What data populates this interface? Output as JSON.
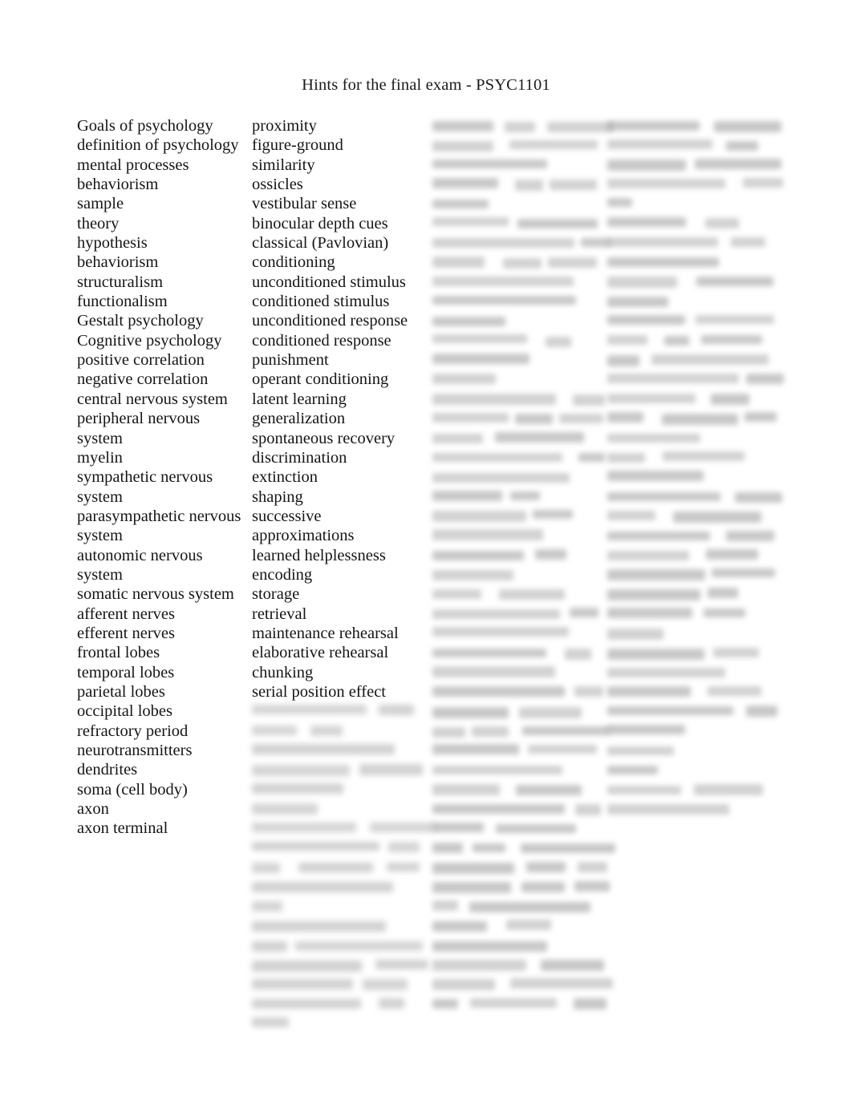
{
  "document": {
    "title": "Hints for the final exam - PSYC1101",
    "page_background": "#ffffff",
    "text_color": "#151515"
  },
  "columns": [
    {
      "id": "column-1",
      "legible": true,
      "terms": [
        "Goals of psychology",
        "definition of psychology",
        "mental processes",
        "behaviorism",
        "sample",
        "theory",
        "hypothesis",
        "behaviorism",
        "structuralism",
        "functionalism",
        "Gestalt psychology",
        "Cognitive psychology",
        "positive correlation",
        "negative correlation",
        "central nervous system",
        "peripheral nervous",
        "system",
        "myelin",
        "sympathetic nervous",
        "system",
        "parasympathetic nervous",
        "system",
        "autonomic nervous",
        "system",
        "somatic nervous system",
        "afferent nerves",
        "efferent nerves",
        "frontal lobes",
        "temporal lobes",
        "parietal lobes",
        "occipital lobes",
        "refractory period",
        "neurotransmitters",
        "dendrites",
        "soma (cell body)",
        "axon",
        "axon terminal"
      ]
    },
    {
      "id": "column-2",
      "legible": true,
      "terms": [
        "proximity",
        "figure-ground",
        "similarity",
        "ossicles",
        "vestibular sense",
        "binocular depth cues",
        "classical (Pavlovian)",
        "conditioning",
        "unconditioned stimulus",
        "conditioned stimulus",
        "unconditioned response",
        "conditioned response",
        "punishment",
        "operant conditioning",
        "latent learning",
        "generalization",
        "spontaneous recovery",
        "discrimination",
        "extinction",
        "shaping",
        "successive",
        "approximations",
        "learned helplessness",
        "encoding",
        "storage",
        "retrieval",
        "maintenance rehearsal",
        "elaborative rehearsal",
        "chunking",
        "serial position effect"
      ],
      "obscured_note": "remaining entries below are blurred and illegible"
    },
    {
      "id": "column-3",
      "legible": false,
      "obscured_note": "entire column is blurred and illegible"
    },
    {
      "id": "column-4",
      "legible": false,
      "obscured_note": "entire column is blurred and illegible"
    }
  ]
}
